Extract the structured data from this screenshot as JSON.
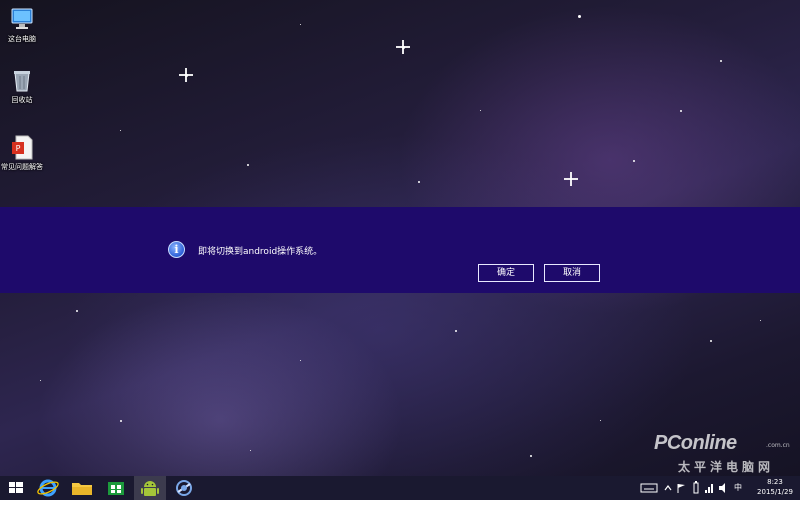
{
  "desktop": {
    "icons": [
      {
        "label": "这台电脑",
        "icon": "computer-icon"
      },
      {
        "label": "回收站",
        "icon": "recycle-bin-icon"
      },
      {
        "label": "常见问题解答",
        "icon": "pdf-document-icon"
      }
    ]
  },
  "dialog": {
    "icon": "info-icon",
    "icon_glyph": "i",
    "message": "即将切换到android操作系统。",
    "ok_label": "确定",
    "cancel_label": "取消",
    "background_color": "#1e0a6b"
  },
  "taskbar": {
    "apps": [
      {
        "name": "start",
        "icon": "windows-start-icon"
      },
      {
        "name": "internet-explorer",
        "icon": "internet-explorer-icon"
      },
      {
        "name": "file-explorer",
        "icon": "folder-icon"
      },
      {
        "name": "store",
        "icon": "store-icon"
      },
      {
        "name": "android",
        "icon": "android-icon"
      },
      {
        "name": "switch-app",
        "icon": "switch-app-icon"
      }
    ],
    "tray": {
      "ime": "中",
      "time": "8:23",
      "date": "2015/1/29"
    }
  },
  "watermark": {
    "brand": "PConline",
    "domain": ".com.cn",
    "chinese": "太平洋电脑网"
  }
}
